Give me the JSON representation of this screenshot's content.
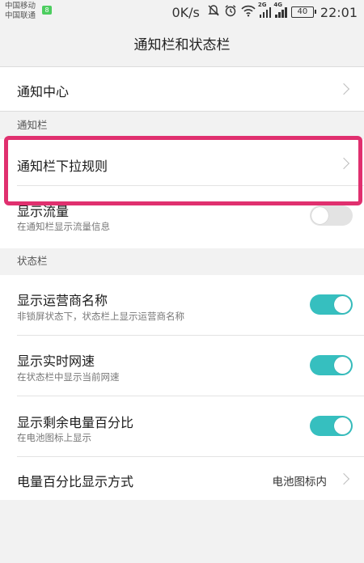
{
  "status_bar": {
    "carrier_1": "中国移动",
    "carrier_2": "中国联通",
    "carrier_badge": "8",
    "net_speed": "0K/s",
    "icons": [
      "mute-icon",
      "alarm-icon",
      "wifi-icon",
      "signal-2g-icon",
      "signal-4g-icon"
    ],
    "signal_label_1": "2G",
    "signal_label_2": "4G",
    "battery": "40",
    "time": "22:01"
  },
  "title": "通知栏和状态栏",
  "rows": {
    "notification_center": {
      "label": "通知中心"
    },
    "pull_down_rule": {
      "label": "通知栏下拉规则"
    },
    "show_traffic": {
      "label": "显示流量",
      "desc": "在通知栏显示流量信息",
      "enabled": false
    },
    "show_carrier": {
      "label": "显示运营商名称",
      "desc": "非锁屏状态下，状态栏上显示运营商名称",
      "enabled": true
    },
    "show_speed": {
      "label": "显示实时网速",
      "desc": "在状态栏中显示当前网速",
      "enabled": true
    },
    "show_battery_pct": {
      "label": "显示剩余电量百分比",
      "desc": "在电池图标上显示",
      "enabled": true
    },
    "battery_pct_mode": {
      "label": "电量百分比显示方式",
      "value": "电池图标内"
    }
  },
  "sections": {
    "notification_bar": "通知栏",
    "status_bar": "状态栏"
  },
  "colors": {
    "accent": "#36bfbf",
    "highlight": "#e0306f",
    "background": "#f2f2f2"
  }
}
